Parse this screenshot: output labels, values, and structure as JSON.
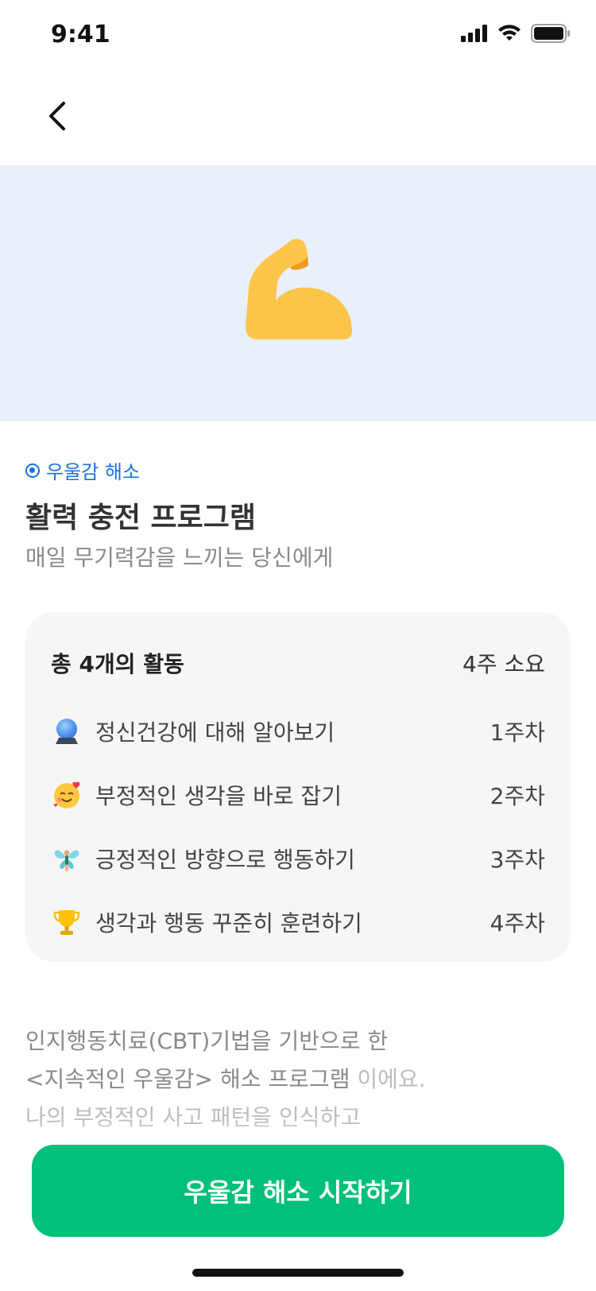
{
  "status_bar": {
    "time": "9:41"
  },
  "program": {
    "category": "우울감 해소",
    "title": "활력 충전 프로그램",
    "subtitle": "매일 무기력감을 느끼는 당신에게"
  },
  "activities": {
    "total_label": "총 4개의 활동",
    "duration_label": "4주 소요",
    "items": [
      {
        "icon": "crystal-ball-icon",
        "label": "정신건강에 대해 알아보기",
        "week": "1주차"
      },
      {
        "icon": "smiling-face-with-hearts-icon",
        "label": "부정적인 생각을 바로 잡기",
        "week": "2주차"
      },
      {
        "icon": "fairy-icon",
        "label": "긍정적인 방향으로 행동하기",
        "week": "3주차"
      },
      {
        "icon": "trophy-icon",
        "label": "생각과 행동 꾸준히 훈련하기",
        "week": "4주차"
      }
    ]
  },
  "description": {
    "line1": "인지행동치료(CBT)기법을 기반으로 한",
    "line2_main": "<지속적인 우울감> 해소 프로그램",
    "line2_dim": " 이에요.",
    "line3": "나의 부정적인 사고 패턴을 인식하고"
  },
  "cta": {
    "label": "우울감 해소 시작하기"
  },
  "colors": {
    "accent_blue": "#1670E8",
    "cta_green": "#00C07A",
    "hero_bg": "#E8F0FB",
    "card_bg": "#F6F6F7"
  },
  "hero": {
    "icon": "flexed-biceps-icon"
  }
}
